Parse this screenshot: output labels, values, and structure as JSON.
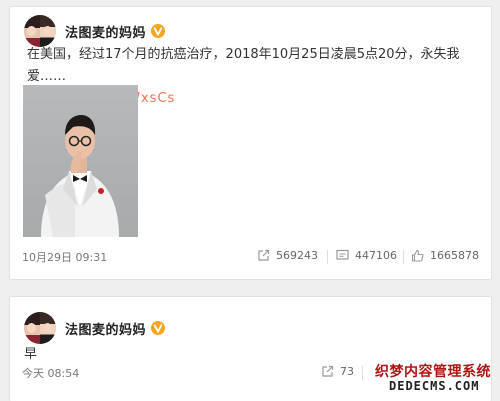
{
  "posts": [
    {
      "author": "法图麦的妈妈",
      "text": "在美国，经过17个月的抗癌治疗，2018年10月25日凌晨5点20分，永失我爱……",
      "link": "http://t.cn/R2WxsCs",
      "timestamp": "10月29日 09:31",
      "reposts": "569243",
      "comments": "447106",
      "likes": "1665878"
    },
    {
      "author": "法图麦的妈妈",
      "text": "早",
      "timestamp": "今天 08:54",
      "reposts": "73"
    }
  ],
  "watermark": {
    "line1": "织梦内容管理系统",
    "line2": "DEDECMS.COM"
  },
  "colors": {
    "link": "#eb7350",
    "verified_badge": "#f5a623",
    "background": "#efefef"
  },
  "icons": [
    "verified-badge-icon",
    "repost-icon",
    "comment-icon",
    "like-icon"
  ]
}
